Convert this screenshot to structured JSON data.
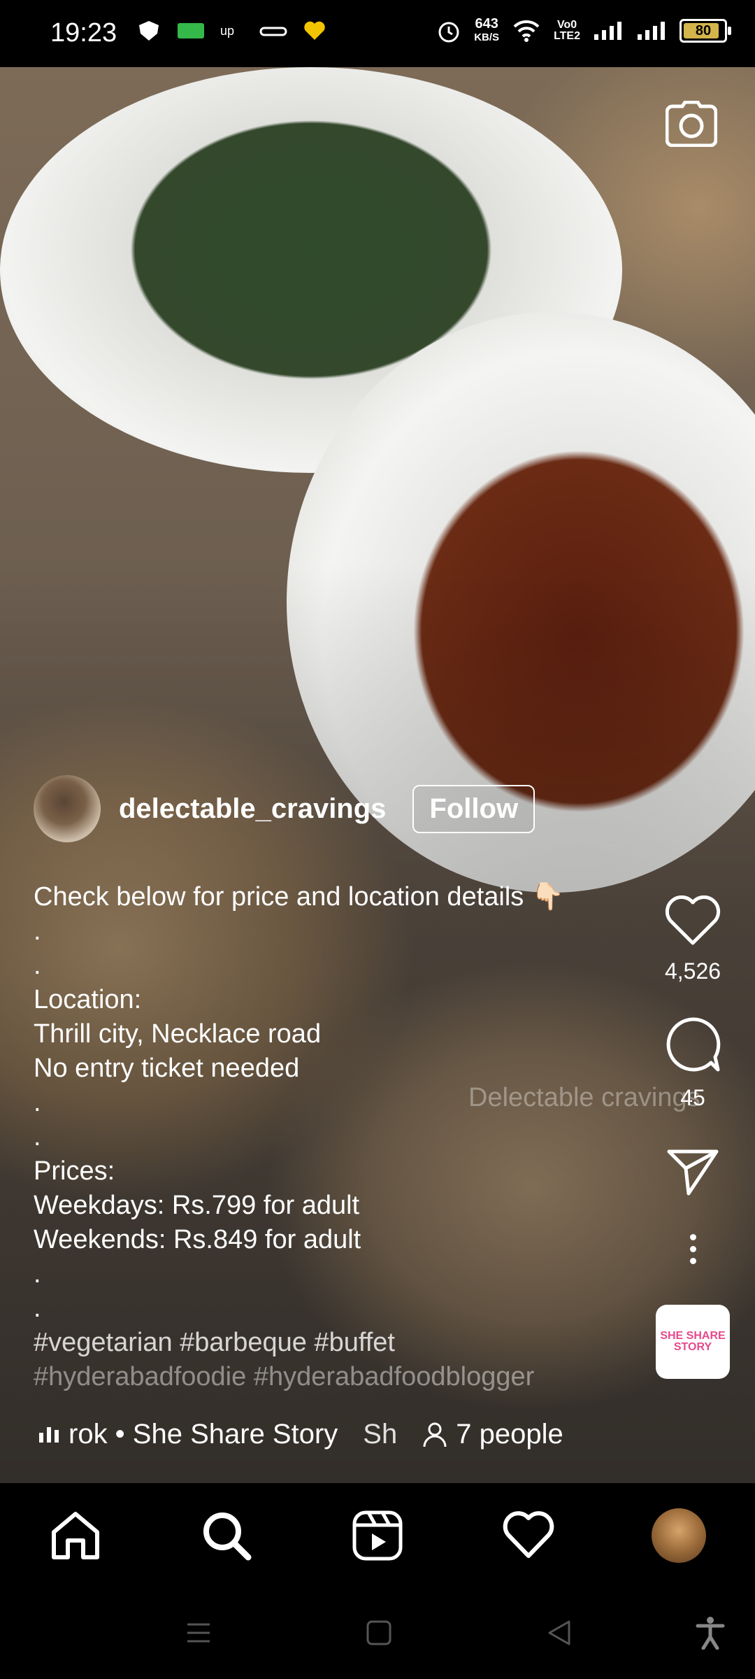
{
  "status_bar": {
    "time": "19:23",
    "speed_value": "643",
    "speed_unit": "KB/S",
    "network_tag_top": "Vo0",
    "network_tag_bottom": "LTE2",
    "battery": "80"
  },
  "post": {
    "username": "delectable_cravings",
    "follow_label": "Follow",
    "caption_lines": [
      "Check below for price and location details 👇🏻",
      ".",
      ".",
      "Location:",
      "Thrill city, Necklace road",
      "No entry ticket needed",
      ".",
      ".",
      "Prices:",
      "Weekdays: Rs.799 for adult",
      "Weekends: Rs.849 for adult",
      ".",
      ".",
      "#vegetarian #barbeque #buffet",
      "#hyderabadfoodie #hyderabadfoodblogger"
    ],
    "watermark": "Delectable cravings",
    "audio_text": "rok • She Share Story",
    "audio_trailing": "Sh",
    "people_count": "7 people"
  },
  "actions": {
    "likes": "4,526",
    "comments": "45",
    "audio_thumb_text": "SHE SHARE STORY"
  },
  "icons": {
    "camera": "camera-icon",
    "like": "heart-icon",
    "comment": "comment-icon",
    "share": "send-icon",
    "more": "more-dots-icon",
    "home": "home-icon",
    "search": "search-icon",
    "reels": "reels-icon",
    "activity": "heart-icon",
    "profile": "profile-avatar"
  },
  "colors": {
    "background": "#000000",
    "text": "#ffffff",
    "battery_fill": "#d4b54b"
  }
}
